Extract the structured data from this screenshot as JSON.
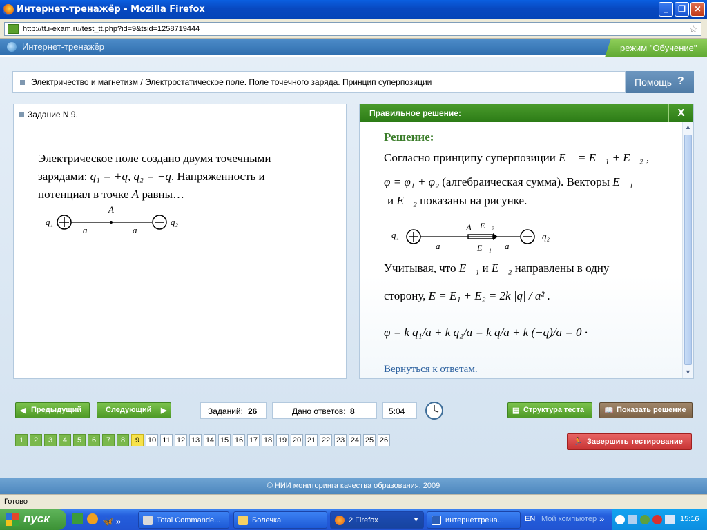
{
  "window": {
    "title": "Интернет-тренажёр - Mozilla Firefox"
  },
  "address": {
    "url": "http://tt.i-exam.ru/test_tt.php?id=9&tsid=1258719444"
  },
  "app": {
    "name": "Интернет-тренажёр",
    "mode": "режим \"Обучение\""
  },
  "topic": {
    "text": "Электричество и магнетизм / Электростатическое поле. Поле точечного заряда. Принцип суперпозиции"
  },
  "help": {
    "label": "Помощь",
    "icon": "question-icon"
  },
  "task": {
    "header": "Задание N 9.",
    "question_part1": "Электрическое поле создано двумя точечными зарядами:",
    "q1": "q₁ = +q",
    "q2": "q₂ = −q",
    "question_part2": ". Напряженность и потенциал в точке",
    "point": "A",
    "question_part3": "равны…",
    "figure": {
      "q1_label": "q₁",
      "q2_label": "q₂",
      "a_label": "a",
      "point_label": "A"
    }
  },
  "solution": {
    "header": "Правильное решение:",
    "close": "X",
    "heading": "Решение:",
    "line1": "Согласно принципу суперпозиции",
    "eq1": "E⃗ = E⃗₁ + E⃗₂ ,",
    "eq2": "φ = φ₁ + φ₂",
    "line2": "(алгебраическая сумма). Векторы",
    "vec_e1": "E⃗₁",
    "conj": "и",
    "vec_e2": "E⃗₂",
    "line3": "показаны на рисунке.",
    "figure": {
      "q1_label": "q₁",
      "q2_label": "q₂",
      "a_label": "a",
      "point_label": "A",
      "e1_label": "E⃗₁",
      "e2_label": "E⃗₂"
    },
    "line4a": "Учитывая, что",
    "line4b": "направлены в одну",
    "line5": "сторону,",
    "eq3": "E = E₁ + E₂ = 2k |q| / a² .",
    "eq4": "φ = k q₁/a + k q₂/a = k q/a + k (−q)/a = 0 ·",
    "back_link": "Вернуться к ответам."
  },
  "controls": {
    "prev": "Предыдущий",
    "next": "Следующий",
    "tasks_label": "Заданий:",
    "tasks_count": "26",
    "answers_label": "Дано ответов:",
    "answers_count": "8",
    "time": "5:04",
    "structure": "Структура теста",
    "show_solution": "Показать решение",
    "finish": "Завершить тестирование"
  },
  "pages": [
    "1",
    "2",
    "3",
    "4",
    "5",
    "6",
    "7",
    "8",
    "9",
    "10",
    "11",
    "12",
    "13",
    "14",
    "15",
    "16",
    "17",
    "18",
    "19",
    "20",
    "21",
    "22",
    "23",
    "24",
    "25",
    "26"
  ],
  "pages_done": 8,
  "current_page": 9,
  "footer": {
    "text": "© НИИ мониторинга качества образования, 2009"
  },
  "status": {
    "text": "Готово"
  },
  "taskbar": {
    "start": "пуск",
    "items": [
      "Total Commande...",
      "Болечка",
      "2 Firefox",
      "интернеттрена..."
    ],
    "lang": "EN",
    "my_computer": "Мой компьютер",
    "clock": "15:16"
  }
}
